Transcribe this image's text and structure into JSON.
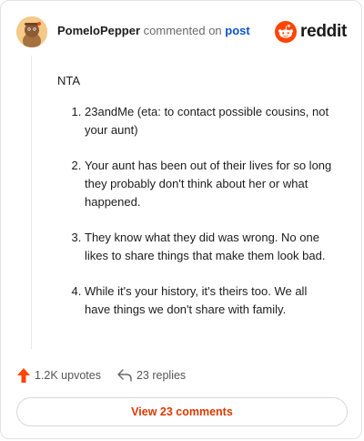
{
  "comment": {
    "username": "PomeloPepper",
    "commented_on_text": "commented on",
    "post_link_text": "post",
    "brand_name": "reddit",
    "intro": "NTA",
    "list_items": [
      "23andMe (eta: to contact possible cousins, not your aunt)",
      "Your aunt has been out of their lives for so long they probably don't think about her or what happened.",
      "They know what they did was wrong. No one likes to share things that make them look bad.",
      "While it's your history, it's theirs too. We all have things we don't share with family."
    ]
  },
  "footer": {
    "upvotes": "1.2K upvotes",
    "replies": "23 replies",
    "view_comments_label": "View 23 comments"
  },
  "colors": {
    "brand": "#ff4500",
    "upvote": "#ff4500",
    "link": "#0a55c8",
    "view_button_text": "#d93a00"
  },
  "icons": {
    "avatar": "snoo-avatar-icon",
    "brand": "reddit-logo-icon",
    "upvote": "upvote-arrow-icon",
    "reply": "reply-arrow-icon"
  }
}
